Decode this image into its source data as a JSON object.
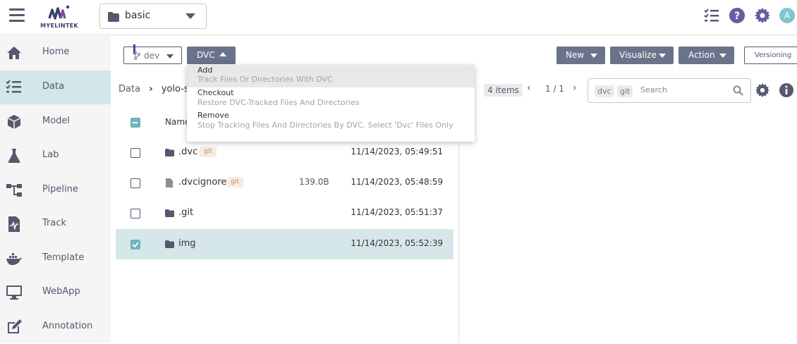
{
  "app": {
    "logo_text": "MYELINTEK",
    "project": "basic",
    "avatar_letter": "A"
  },
  "sidebar": {
    "items": [
      {
        "label": "Home",
        "icon": "home-icon"
      },
      {
        "label": "Data",
        "icon": "list-icon",
        "active": true
      },
      {
        "label": "Model",
        "icon": "cube-icon"
      },
      {
        "label": "Lab",
        "icon": "flask-icon"
      },
      {
        "label": "Pipeline",
        "icon": "pipeline-icon"
      },
      {
        "label": "Track",
        "icon": "track-icon"
      },
      {
        "label": "Template",
        "icon": "docker-icon"
      },
      {
        "label": "WebApp",
        "icon": "monitor-icon"
      },
      {
        "label": "Annotation",
        "icon": "edit-icon"
      }
    ]
  },
  "toolbar": {
    "branch": "dev",
    "dvc": "DVC",
    "new": "New",
    "visualize": "Visualize",
    "action": "Action",
    "versioning": "Versioning"
  },
  "breadcrumb": {
    "root": "Data",
    "current": "yolo-sa"
  },
  "pagination": {
    "items": "4 items",
    "page": "1 / 1"
  },
  "search": {
    "tags": [
      "dvc",
      "git"
    ],
    "placeholder": "Search"
  },
  "table": {
    "header_name": "Name",
    "rows": [
      {
        "name": ".dvc",
        "type": "folder",
        "tag": "git",
        "size": "",
        "date": "11/14/2023, 05:49:51",
        "checked": false
      },
      {
        "name": ".dvcignore",
        "type": "file",
        "tag": "git",
        "size": "139.0B",
        "date": "11/14/2023, 05:48:59",
        "checked": false
      },
      {
        "name": ".git",
        "type": "folder",
        "tag": "",
        "size": "",
        "date": "11/14/2023, 05:51:37",
        "checked": false
      },
      {
        "name": "img",
        "type": "folder",
        "tag": "",
        "size": "",
        "date": "11/14/2023, 05:52:39",
        "checked": true
      }
    ]
  },
  "dvc_menu": {
    "items": [
      {
        "title": "Add",
        "desc": "Track Files Or Directories With DVC"
      },
      {
        "title": "Checkout",
        "desc": "Restore DVC-Tracked Files And Directories"
      },
      {
        "title": "Remove",
        "desc": "Stop Tracking Files And Directories By DVC. Select 'Dvc' Files Only"
      }
    ]
  },
  "colors": {
    "accent": "#6a7389",
    "teal": "#6fb3bf",
    "brand": "#3a3f6b",
    "active_nav": "#d3e6ea"
  }
}
